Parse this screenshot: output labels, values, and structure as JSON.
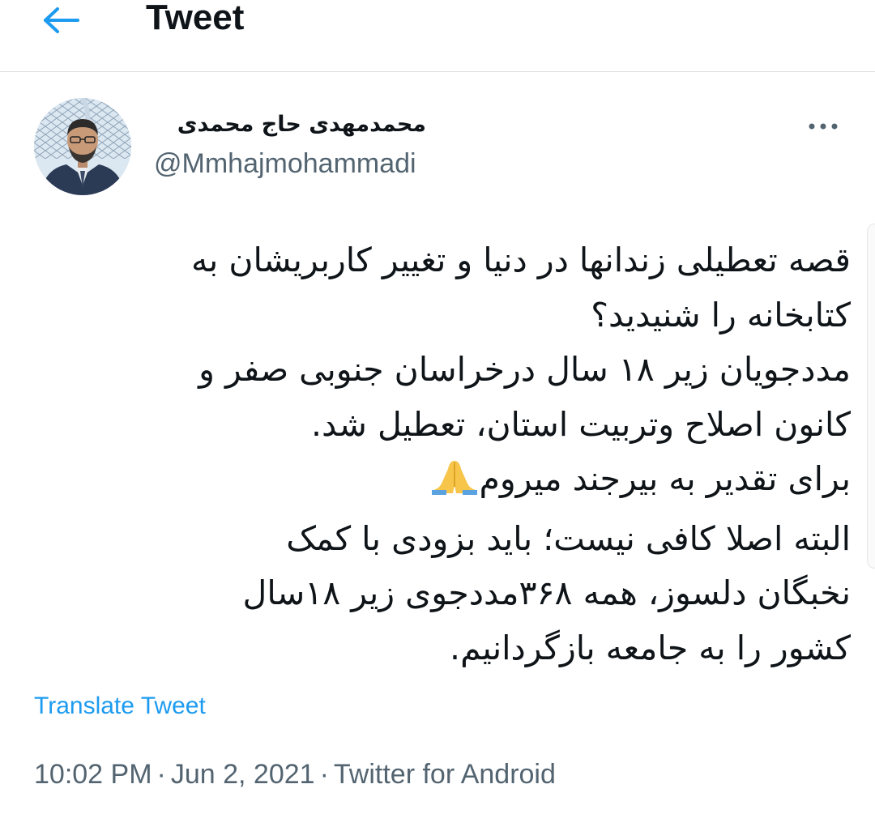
{
  "header": {
    "title": "Tweet",
    "back_icon": "arrow-left-icon",
    "accent_color": "#1d9bf0"
  },
  "author": {
    "display_name": "محمدمهدی حاج محمدی",
    "handle": "@Mmhajmohammadi",
    "avatar_icon": "avatar-photo"
  },
  "more_icon": "more-dots-icon",
  "tweet": {
    "lines": [
      "قصه تعطیلی زندانها در دنیا و تغییر کاربریشان به",
      "کتابخانه را شنیدید؟",
      "مددجویان زیر ۱۸ سال درخراسان جنوبی صفر و",
      "کانون اصلاح وتربیت استان، تعطیل شد.",
      "برای تقدیر به بیرجند میروم",
      "البته اصلا کافی نیست؛ باید بزودی با کمک",
      "نخبگان دلسوز، همه ۳۶۸مددجوی زیر ۱۸سال",
      "کشور را به جامعه بازگردانیم."
    ],
    "emoji": "folded-hands-icon",
    "translate_label": "Translate Tweet"
  },
  "meta": {
    "time": "10:02 PM",
    "separator": "·",
    "date": "Jun 2, 2021",
    "source": "Twitter for Android"
  },
  "colors": {
    "text": "#0f1419",
    "secondary": "#536471",
    "link": "#1d9bf0",
    "divider": "#d8dde1"
  }
}
